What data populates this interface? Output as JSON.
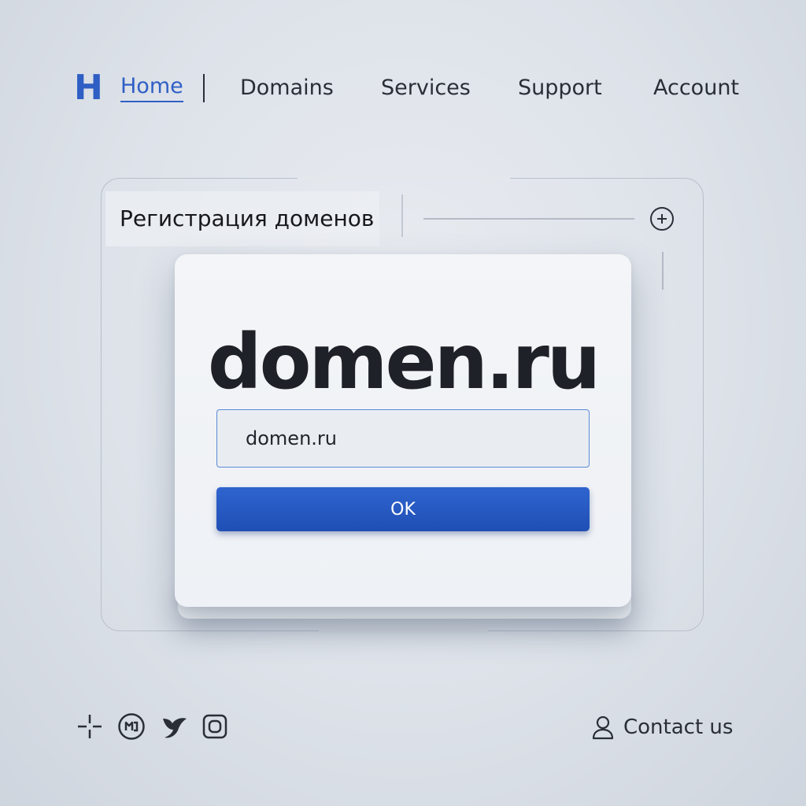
{
  "nav": {
    "logo": "H",
    "items": [
      {
        "label": "Home",
        "active": true
      },
      {
        "label": "Domains",
        "active": false
      },
      {
        "label": "Services",
        "active": false
      },
      {
        "label": "Support",
        "active": false
      },
      {
        "label": "Account",
        "active": false
      }
    ]
  },
  "frame": {
    "title": "Регистрация доменов",
    "action_icon": "plus-circle-icon"
  },
  "card": {
    "title": "domen.ru",
    "input_value": "domen.ru",
    "button_label": "OK"
  },
  "footer": {
    "social_icons": [
      "crosshair-icon",
      "messenger-icon",
      "bird-icon",
      "instagram-icon"
    ],
    "contact_label": "Contact us",
    "contact_icon": "user-icon"
  },
  "colors": {
    "accent": "#2f5fc4",
    "button": "#2459c2",
    "text": "#1d2026",
    "background": "#dde2e9"
  }
}
